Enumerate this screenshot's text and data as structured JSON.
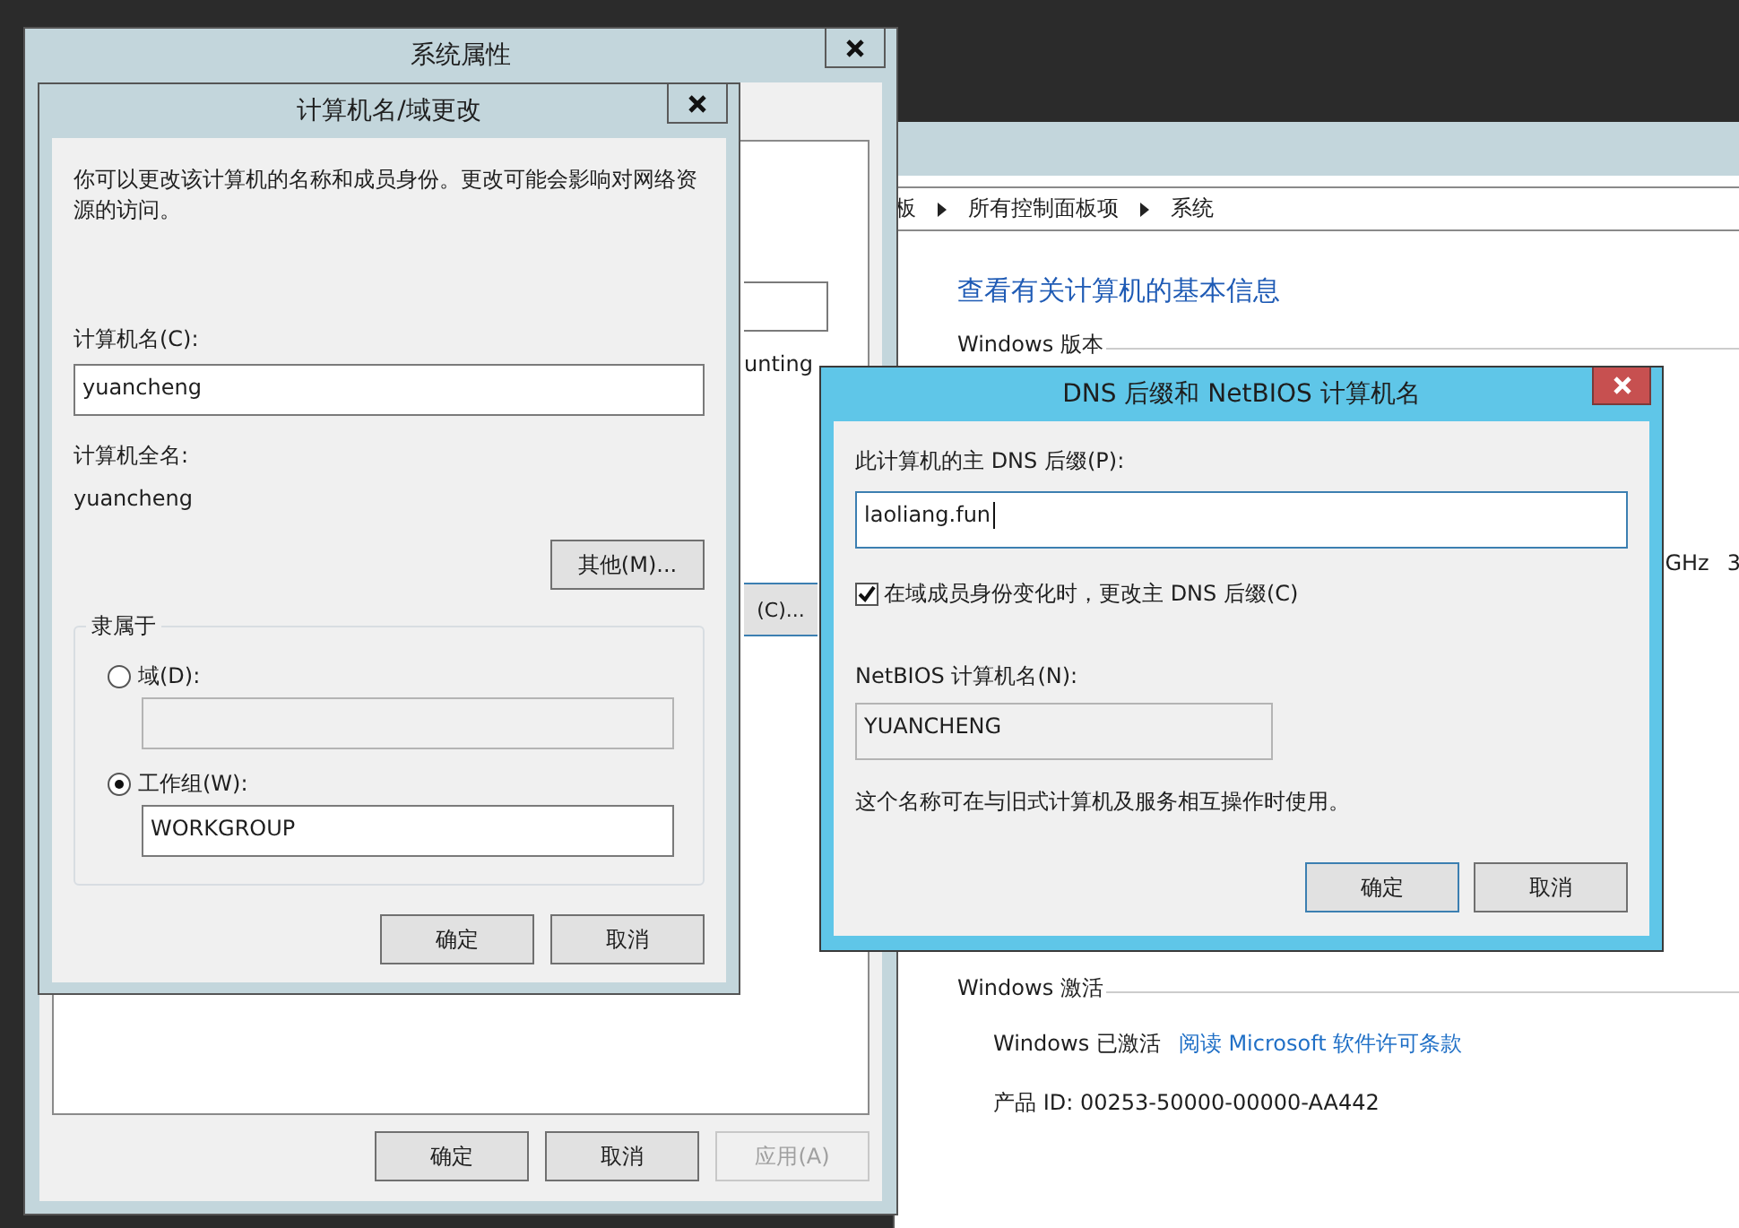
{
  "control_panel": {
    "breadcrumb": [
      "板",
      "所有控制面板项",
      "系统"
    ],
    "heading": "查看有关计算机的基本信息",
    "version_section": "Windows 版本",
    "cpu_partial": [
      "GHz",
      "3"
    ],
    "activation": {
      "title": "Windows 激活",
      "status": "Windows 已激活",
      "link": "阅读 Microsoft 软件许可条款",
      "product_id": "产品 ID: 00253-50000-00000-AA442"
    }
  },
  "system_properties": {
    "title": "系统属性",
    "partial_text": "unting",
    "partial_button": "(C)...",
    "buttons": [
      {
        "label": "确定",
        "disabled": false
      },
      {
        "label": "取消",
        "disabled": false
      },
      {
        "label": "应用(A)",
        "disabled": true
      }
    ]
  },
  "computer_name_dialog": {
    "title": "计算机名/域更改",
    "description": "你可以更改该计算机的名称和成员身份。更改可能会影响对网络资源的访问。",
    "name_label": "计算机名(C):",
    "name_value": "yuancheng",
    "full_name_label": "计算机全名:",
    "full_name": "yuancheng",
    "more_button": "其他(M)...",
    "member_of": {
      "legend": "隶属于",
      "options": [
        {
          "label": "域(D):",
          "selected": false,
          "field_disabled": true
        },
        {
          "label": "工作组(W):",
          "selected": true,
          "field_disabled": false,
          "value": "WORKGROUP"
        }
      ]
    },
    "buttons": [
      "确定",
      "取消"
    ]
  },
  "dns_dialog": {
    "title": "DNS 后缀和 NetBIOS 计算机名",
    "suffix_label": "此计算机的主 DNS 后缀(P):",
    "suffix_value": "laoliang.fun",
    "checkbox": {
      "label": "在域成员身份变化时，更改主 DNS 后缀(C)",
      "checked": true
    },
    "netbios_label": "NetBIOS 计算机名(N):",
    "netbios_value": "YUANCHENG",
    "note": "这个名称可在与旧式计算机及服务相互操作时使用。",
    "buttons": [
      {
        "label": "确定",
        "default": true
      },
      {
        "label": "取消",
        "default": false
      }
    ]
  }
}
